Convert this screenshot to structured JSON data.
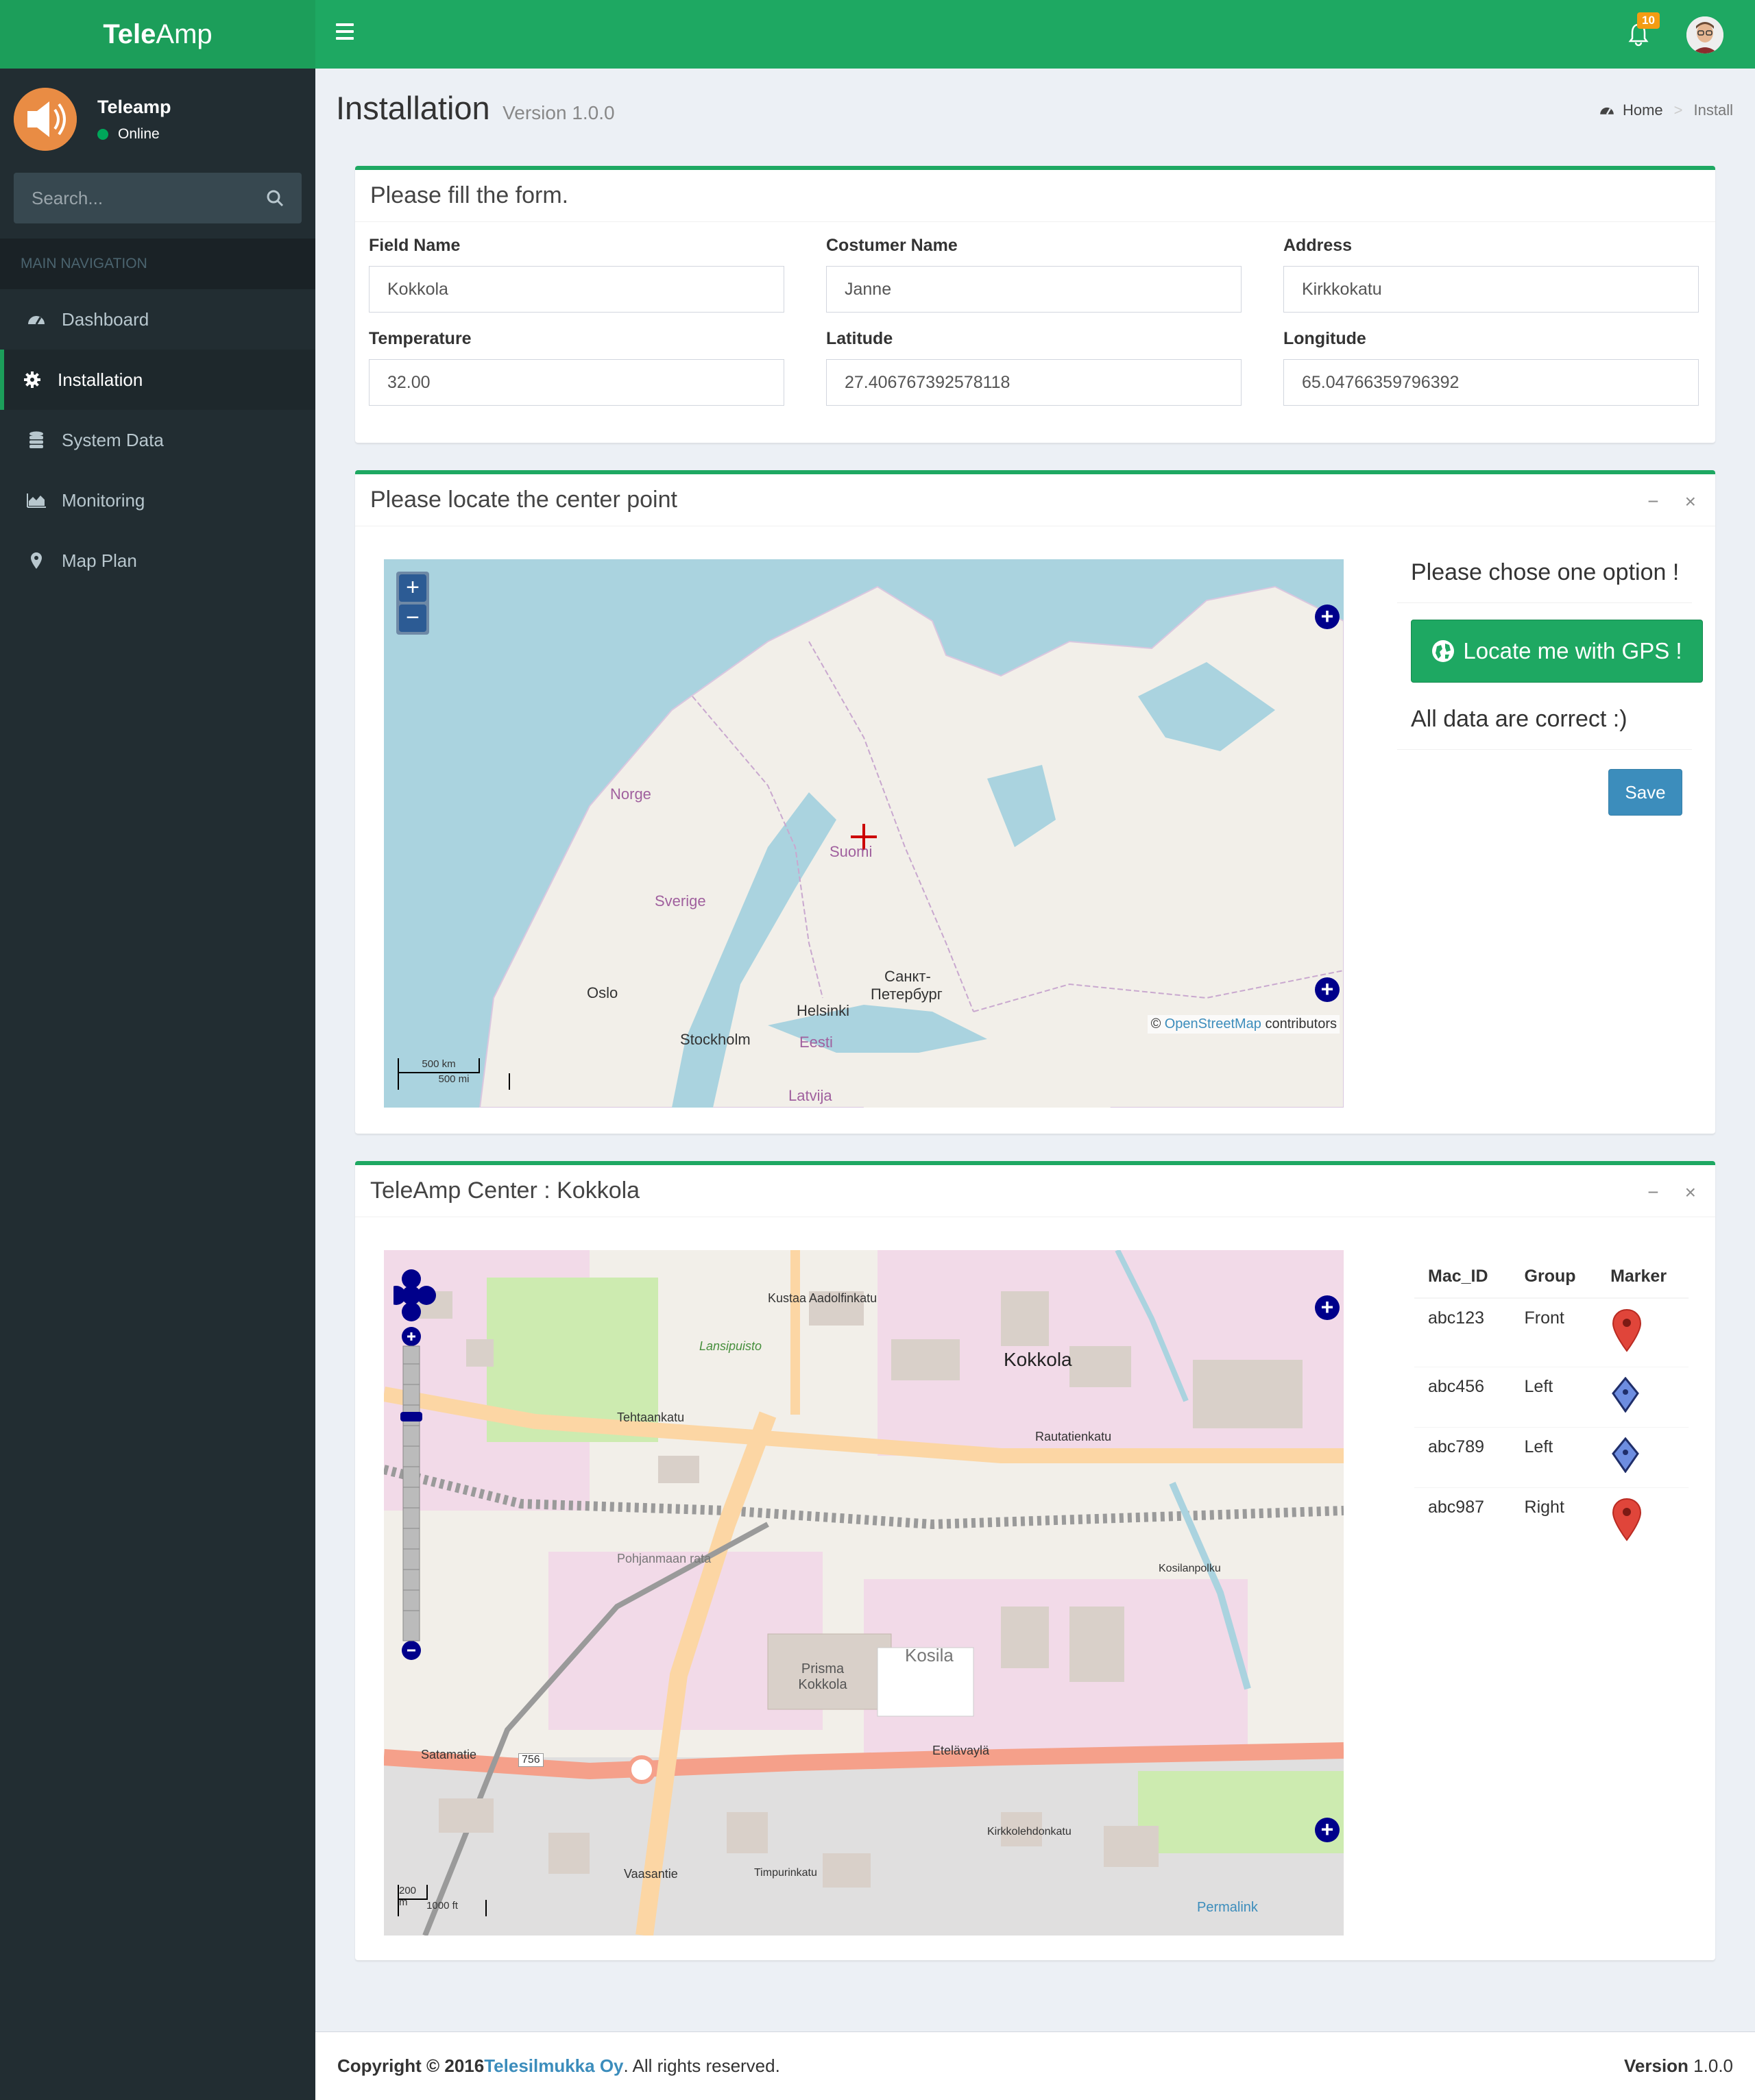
{
  "app": {
    "logo_bold": "Tele",
    "logo_light": "Amp",
    "brand_color": "#1ea862"
  },
  "user": {
    "name": "Teleamp",
    "status": "Online"
  },
  "sidebar": {
    "search_placeholder": "Search...",
    "header": "MAIN NAVIGATION",
    "items": [
      {
        "label": "Dashboard",
        "icon": "dashboard-icon"
      },
      {
        "label": "Installation",
        "icon": "gear-icon",
        "active": true
      },
      {
        "label": "System Data",
        "icon": "database-icon"
      },
      {
        "label": "Monitoring",
        "icon": "area-chart-icon"
      },
      {
        "label": "Map Plan",
        "icon": "map-marker-icon"
      }
    ]
  },
  "topbar": {
    "notifications": "10"
  },
  "page": {
    "title": "Installation",
    "subtitle": "Version 1.0.0"
  },
  "breadcrumb": {
    "home": "Home",
    "current": "Install"
  },
  "form_box": {
    "title": "Please fill the form.",
    "fields": [
      {
        "label": "Field Name",
        "value": "Kokkola"
      },
      {
        "label": "Costumer Name",
        "value": "Janne"
      },
      {
        "label": "Address",
        "value": "Kirkkokatu"
      },
      {
        "label": "Temperature",
        "value": "32.00"
      },
      {
        "label": "Latitude",
        "value": "27.406767392578118"
      },
      {
        "label": "Longitude",
        "value": "65.04766359796392"
      }
    ]
  },
  "locate_box": {
    "title": "Please locate the center point",
    "minimize": "−",
    "close": "×",
    "option_title": "Please chose one option !",
    "gps_button": "Locate me with GPS !",
    "status_msg": "All data are correct :)",
    "save_button": "Save",
    "map": {
      "zoom_in": "+",
      "zoom_out": "−",
      "labels": [
        "Norge",
        "Suomi",
        "Sverige",
        "Oslo",
        "Stockholm",
        "Helsinki",
        "Санкт-",
        "Петербург",
        "Eesti",
        "Latvija"
      ],
      "attribution_prefix": "©",
      "attribution_link": "OpenStreetMap",
      "attribution_suffix": "contributors",
      "scale_km": "500 km",
      "scale_mi": "500 mi"
    }
  },
  "center_box": {
    "title": "TeleAmp Center : Kokkola",
    "minimize": "−",
    "close": "×",
    "map": {
      "labels": [
        "Kokkola",
        "Rautatienkatu",
        "Tehtaankatu",
        "Lansipuisto",
        "Prisma Kokkola",
        "Kosila",
        "Etelävaylä",
        "Satamatie",
        "Vaasantie",
        "Kustaa Aadolfinkatu",
        "Pohjanmaan rata",
        "Kosilanpolku",
        "Kirkkolehdonkatu",
        "Timpurinkatu",
        "756"
      ],
      "scale_m": "200 m",
      "scale_ft": "1000 ft",
      "permalink": "Permalink"
    },
    "table": {
      "headers": [
        "Mac_ID",
        "Group",
        "Marker"
      ],
      "rows": [
        {
          "mac": "abc123",
          "group": "Front",
          "marker": "red-pin-icon"
        },
        {
          "mac": "abc456",
          "group": "Left",
          "marker": "blue-diamond-icon"
        },
        {
          "mac": "abc789",
          "group": "Left",
          "marker": "blue-diamond-icon"
        },
        {
          "mac": "abc987",
          "group": "Right",
          "marker": "red-pin-icon"
        }
      ]
    }
  },
  "footer": {
    "copyright": "Copyright © 2016",
    "company": "Telesilmukka Oy",
    "rights": ". All rights reserved.",
    "version_label": "Version",
    "version": "1.0.0"
  }
}
